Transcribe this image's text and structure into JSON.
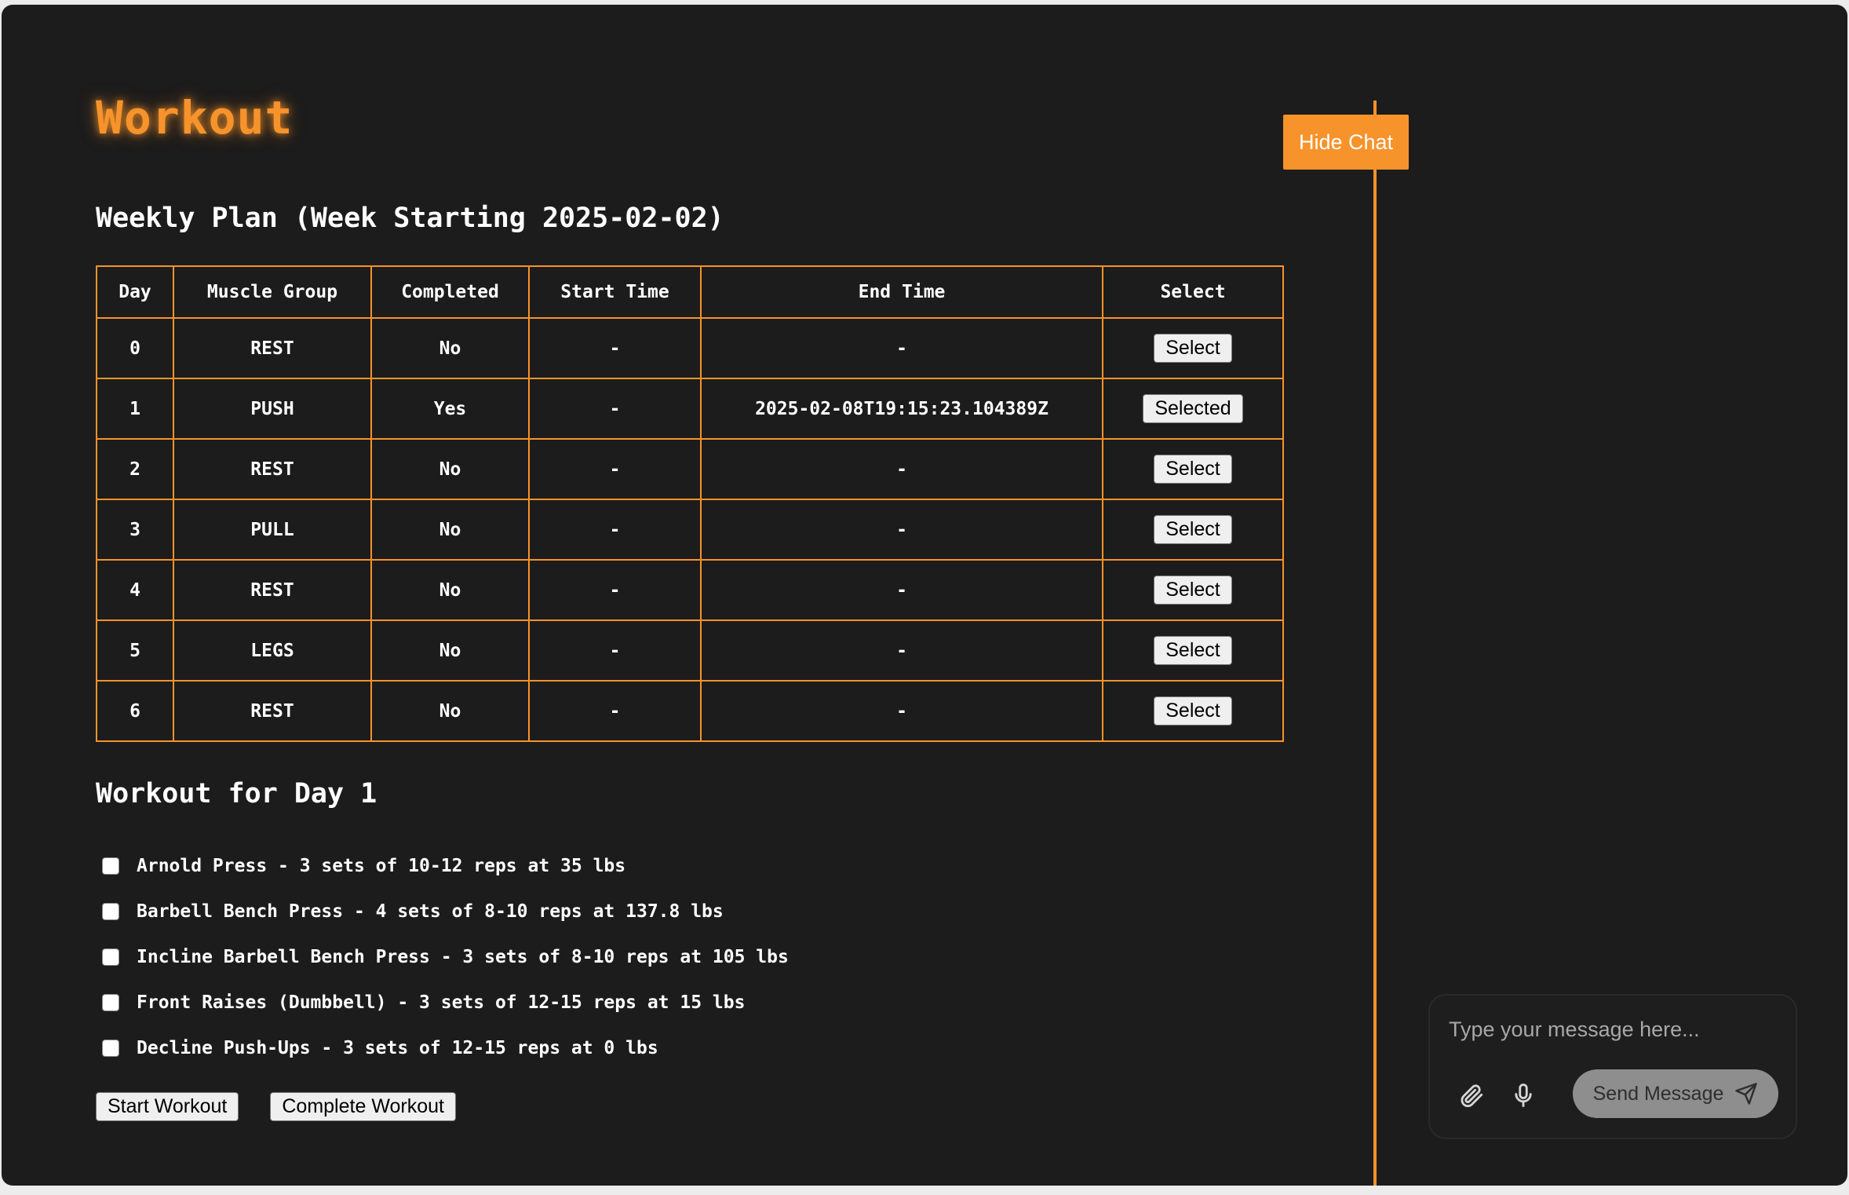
{
  "app": {
    "title": "Workout"
  },
  "weekly_plan": {
    "title": "Weekly Plan (Week Starting 2025-02-02)",
    "columns": [
      "Day",
      "Muscle Group",
      "Completed",
      "Start Time",
      "End Time",
      "Select"
    ],
    "rows": [
      {
        "day": "0",
        "muscle_group": "REST",
        "completed": "No",
        "start_time": "-",
        "end_time": "-",
        "select_label": "Select"
      },
      {
        "day": "1",
        "muscle_group": "PUSH",
        "completed": "Yes",
        "start_time": "-",
        "end_time": "2025-02-08T19:15:23.104389Z",
        "select_label": "Selected"
      },
      {
        "day": "2",
        "muscle_group": "REST",
        "completed": "No",
        "start_time": "-",
        "end_time": "-",
        "select_label": "Select"
      },
      {
        "day": "3",
        "muscle_group": "PULL",
        "completed": "No",
        "start_time": "-",
        "end_time": "-",
        "select_label": "Select"
      },
      {
        "day": "4",
        "muscle_group": "REST",
        "completed": "No",
        "start_time": "-",
        "end_time": "-",
        "select_label": "Select"
      },
      {
        "day": "5",
        "muscle_group": "LEGS",
        "completed": "No",
        "start_time": "-",
        "end_time": "-",
        "select_label": "Select"
      },
      {
        "day": "6",
        "muscle_group": "REST",
        "completed": "No",
        "start_time": "-",
        "end_time": "-",
        "select_label": "Select"
      }
    ]
  },
  "day_workout": {
    "title": "Workout for Day 1",
    "exercises": [
      {
        "text": "Arnold Press - 3 sets of 10-12 reps at 35 lbs",
        "checked": false
      },
      {
        "text": "Barbell Bench Press - 4 sets of 8-10 reps at 137.8 lbs",
        "checked": false
      },
      {
        "text": "Incline Barbell Bench Press - 3 sets of 8-10 reps at 105 lbs",
        "checked": false
      },
      {
        "text": "Front Raises (Dumbbell) - 3 sets of 12-15 reps at 15 lbs",
        "checked": false
      },
      {
        "text": "Decline Push-Ups - 3 sets of 12-15 reps at 0 lbs",
        "checked": false
      }
    ],
    "start_label": "Start Workout",
    "complete_label": "Complete Workout"
  },
  "chat": {
    "hide_label": "Hide Chat",
    "input_placeholder": "Type your message here...",
    "input_value": "",
    "send_label": "Send Message",
    "attach_icon": "paperclip-icon",
    "mic_icon": "microphone-icon",
    "send_icon": "paper-plane-icon"
  },
  "colors": {
    "accent": "#f7932b",
    "background": "#1c1c1c",
    "send_button": "#8e8e8e"
  }
}
